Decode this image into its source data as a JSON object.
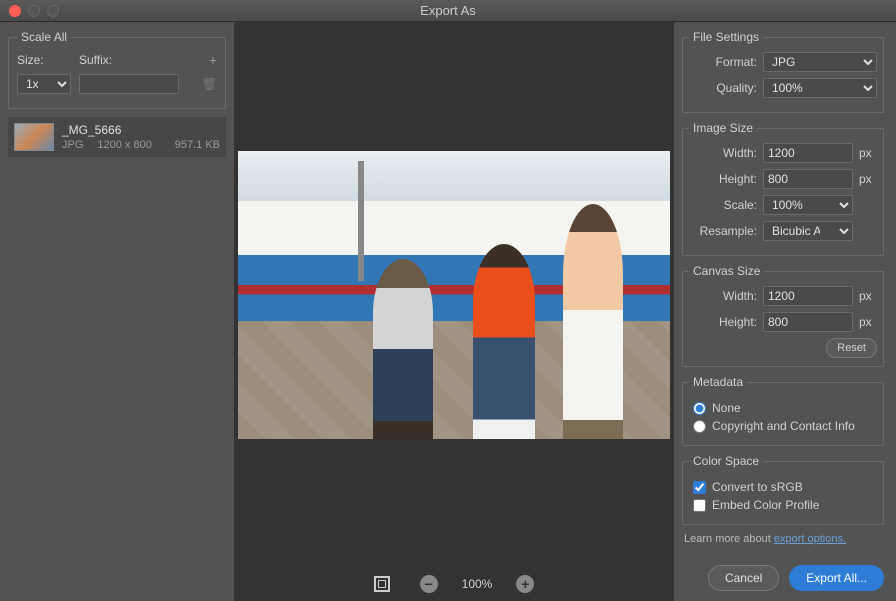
{
  "title": "Export As",
  "scaleAll": {
    "legend": "Scale All",
    "sizeLabel": "Size:",
    "suffixLabel": "Suffix:",
    "sizeValue": "1x",
    "suffixValue": ""
  },
  "fileItem": {
    "name": "_MG_5666",
    "format": "JPG",
    "dimensions": "1200 x 800",
    "filesize": "957.1 KB"
  },
  "zoom": {
    "level": "100%"
  },
  "fileSettings": {
    "legend": "File Settings",
    "formatLabel": "Format:",
    "formatValue": "JPG",
    "qualityLabel": "Quality:",
    "qualityValue": "100%"
  },
  "imageSize": {
    "legend": "Image Size",
    "widthLabel": "Width:",
    "widthValue": "1200",
    "heightLabel": "Height:",
    "heightValue": "800",
    "scaleLabel": "Scale:",
    "scaleValue": "100%",
    "resampleLabel": "Resample:",
    "resampleValue": "Bicubic Aut...",
    "unit": "px"
  },
  "canvasSize": {
    "legend": "Canvas Size",
    "widthLabel": "Width:",
    "widthValue": "1200",
    "heightLabel": "Height:",
    "heightValue": "800",
    "unit": "px",
    "resetLabel": "Reset"
  },
  "metadata": {
    "legend": "Metadata",
    "noneLabel": "None",
    "copyrightLabel": "Copyright and Contact Info"
  },
  "colorSpace": {
    "legend": "Color Space",
    "convertLabel": "Convert to sRGB",
    "embedLabel": "Embed Color Profile"
  },
  "learnMore": {
    "text": "Learn more about ",
    "link": "export options."
  },
  "buttons": {
    "cancel": "Cancel",
    "export": "Export All..."
  }
}
